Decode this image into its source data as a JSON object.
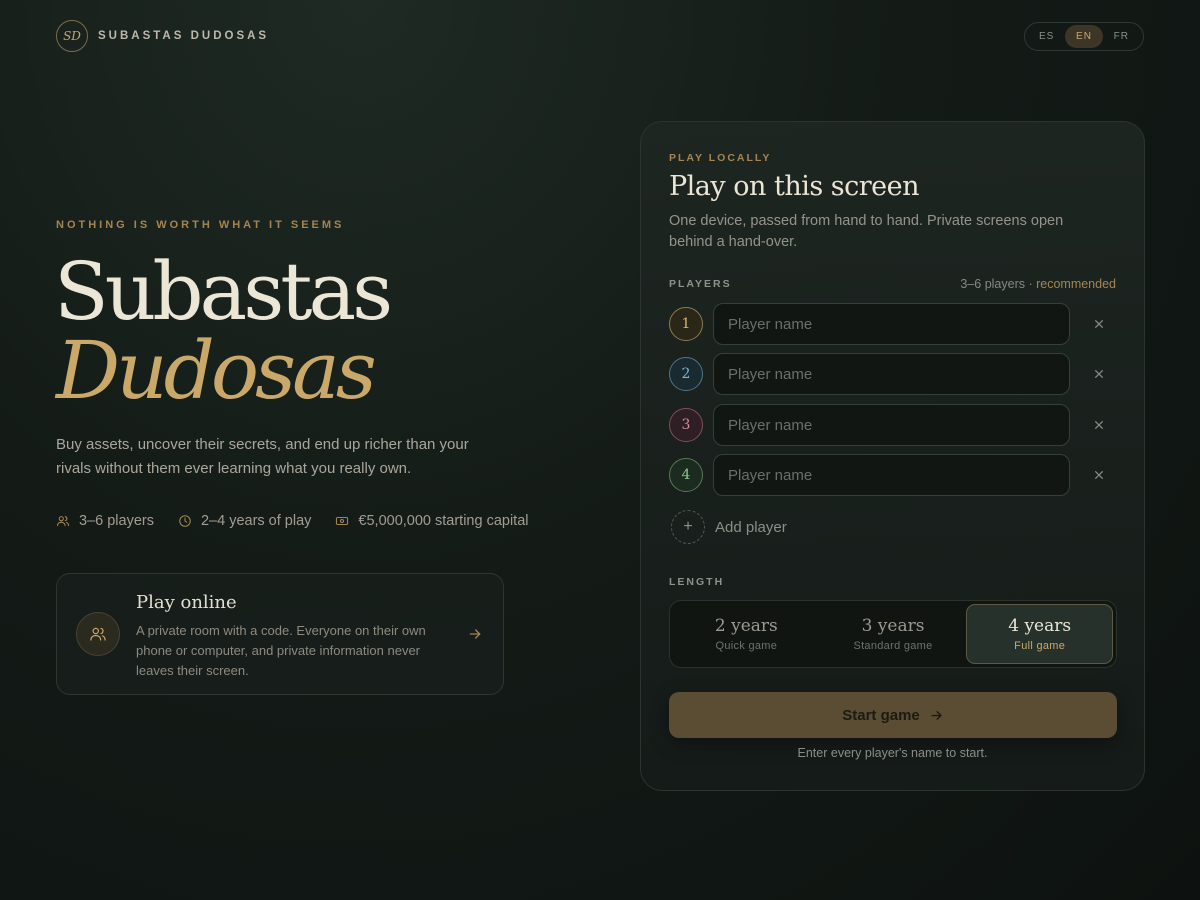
{
  "header": {
    "logo_mark": "SD",
    "brand": "SUBASTAS DUDOSAS",
    "languages": [
      {
        "code": "ES",
        "active": false
      },
      {
        "code": "EN",
        "active": true
      },
      {
        "code": "FR",
        "active": false
      }
    ]
  },
  "hero": {
    "eyebrow": "NOTHING IS WORTH WHAT IT SEEMS",
    "title_line1": "Subastas",
    "title_line2": "Dudosas",
    "tagline": "Buy assets, uncover their secrets, and end up richer than your rivals without them ever learning what you really own.",
    "stats": [
      {
        "icon": "users-icon",
        "label": "3–6 players"
      },
      {
        "icon": "clock-icon",
        "label": "2–4 years of play"
      },
      {
        "icon": "banknote-icon",
        "label": "€5,000,000 starting capital"
      }
    ]
  },
  "online": {
    "icon": "users-icon",
    "title": "Play online",
    "description": "A private room with a code. Everyone on their own phone or computer, and private information never leaves their screen."
  },
  "local": {
    "eyebrow": "PLAY LOCALLY",
    "title": "Play on this screen",
    "description": "One device, passed from hand to hand. Private screens open behind a hand-over.",
    "players_label": "PLAYERS",
    "players_hint": "3–6 players · ",
    "players_hint_accent": "recommended",
    "players": [
      {
        "number": "1",
        "placeholder": "Player name",
        "value": "",
        "color": "#d9b772"
      },
      {
        "number": "2",
        "placeholder": "Player name",
        "value": "",
        "color": "#7fb6d6"
      },
      {
        "number": "3",
        "placeholder": "Player name",
        "value": "",
        "color": "#d98a9a"
      },
      {
        "number": "4",
        "placeholder": "Player name",
        "value": "",
        "color": "#8fc790"
      }
    ],
    "add_player": "Add player",
    "length_label": "LENGTH",
    "lengths": [
      {
        "label": "2 years",
        "sub": "Quick game",
        "active": false
      },
      {
        "label": "3 years",
        "sub": "Standard game",
        "active": false
      },
      {
        "label": "4 years",
        "sub": "Full game",
        "active": true
      }
    ],
    "start_label": "Start game",
    "start_note": "Enter every player's name to start."
  },
  "colors": {
    "accent": "#c9a86a",
    "background": "#141b17",
    "panel": "#1b2320"
  }
}
